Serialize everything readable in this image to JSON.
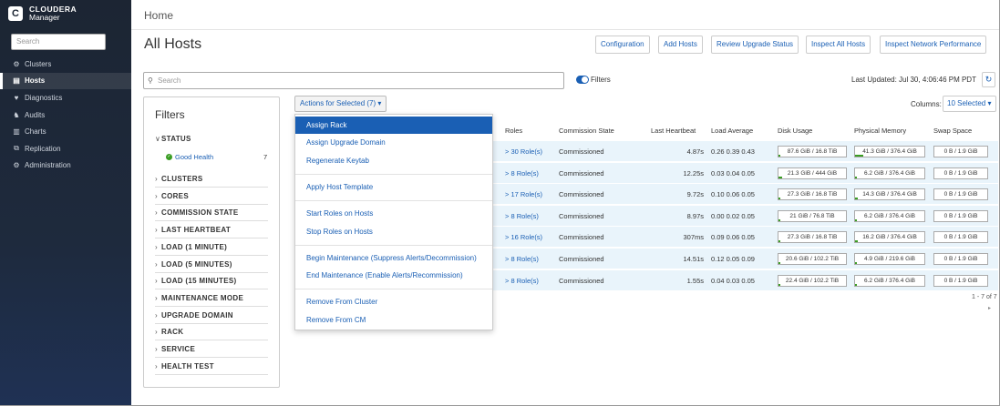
{
  "brand": {
    "line1": "CLOUDERA",
    "line2": "Manager",
    "mark": "C"
  },
  "sidebar": {
    "search_placeholder": "Search",
    "items": [
      {
        "label": "Clusters",
        "icon": "cluster-icon",
        "glyph": "⚙"
      },
      {
        "label": "Hosts",
        "icon": "hosts-icon",
        "glyph": "▤",
        "active": true
      },
      {
        "label": "Diagnostics",
        "icon": "heart-icon",
        "glyph": "♥"
      },
      {
        "label": "Audits",
        "icon": "audit-icon",
        "glyph": "♞"
      },
      {
        "label": "Charts",
        "icon": "chart-icon",
        "glyph": "▥"
      },
      {
        "label": "Replication",
        "icon": "replication-icon",
        "glyph": "⧉"
      },
      {
        "label": "Administration",
        "icon": "gear-icon",
        "glyph": "⚙"
      }
    ]
  },
  "breadcrumb": "Home",
  "page_title": "All Hosts",
  "buttons": [
    "Configuration",
    "Add Hosts",
    "Review Upgrade Status",
    "Inspect All Hosts",
    "Inspect Network Performance"
  ],
  "search": {
    "placeholder": "Search"
  },
  "filters_toggle_label": "Filters",
  "last_updated": "Last Updated: Jul 30, 4:06:46 PM PDT",
  "actions_label": "Actions for Selected (7) ▾",
  "columns_label": "Columns:",
  "columns_value": "10 Selected ▾",
  "filters_panel": {
    "title": "Filters",
    "status_label": "STATUS",
    "good_health": "Good Health",
    "good_health_count": "7",
    "groups": [
      "CLUSTERS",
      "CORES",
      "COMMISSION STATE",
      "LAST HEARTBEAT",
      "LOAD (1 MINUTE)",
      "LOAD (5 MINUTES)",
      "LOAD (15 MINUTES)",
      "MAINTENANCE MODE",
      "UPGRADE DOMAIN",
      "RACK",
      "SERVICE",
      "HEALTH TEST"
    ]
  },
  "table": {
    "headers": [
      "Roles",
      "Commission State",
      "Last Heartbeat",
      "Load Average",
      "Disk Usage",
      "Physical Memory",
      "Swap Space"
    ],
    "rows": [
      {
        "roles": "> 30 Role(s)",
        "state": "Commissioned",
        "heartbeat": "4.87s",
        "load": "0.26 0.39 0.43",
        "disk": "87.6 GiB / 16.8 TiB",
        "disk_frac": 0.01,
        "mem": "41.3 GiB / 376.4 GiB",
        "mem_frac": 0.11,
        "swap": "0 B / 1.9 GiB"
      },
      {
        "roles": "> 8 Role(s)",
        "state": "Commissioned",
        "heartbeat": "12.25s",
        "load": "0.03 0.04 0.05",
        "disk": "21.3 GiB / 444 GiB",
        "disk_frac": 0.05,
        "mem": "6.2 GiB / 376.4 GiB",
        "mem_frac": 0.02,
        "swap": "0 B / 1.9 GiB"
      },
      {
        "roles": "> 17 Role(s)",
        "state": "Commissioned",
        "heartbeat": "9.72s",
        "load": "0.10 0.06 0.05",
        "disk": "27.3 GiB / 16.8 TiB",
        "disk_frac": 0.0,
        "mem": "14.3 GiB / 376.4 GiB",
        "mem_frac": 0.04,
        "swap": "0 B / 1.9 GiB"
      },
      {
        "roles": "> 8 Role(s)",
        "state": "Commissioned",
        "heartbeat": "8.97s",
        "load": "0.00 0.02 0.05",
        "disk": "21 GiB / 76.8 TiB",
        "disk_frac": 0.0,
        "mem": "6.2 GiB / 376.4 GiB",
        "mem_frac": 0.02,
        "swap": "0 B / 1.9 GiB"
      },
      {
        "roles": "> 16 Role(s)",
        "state": "Commissioned",
        "heartbeat": "307ms",
        "load": "0.09 0.06 0.05",
        "disk": "27.3 GiB / 16.8 TiB",
        "disk_frac": 0.0,
        "mem": "16.2 GiB / 376.4 GiB",
        "mem_frac": 0.04,
        "swap": "0 B / 1.9 GiB"
      },
      {
        "roles": "> 8 Role(s)",
        "state": "Commissioned",
        "heartbeat": "14.51s",
        "load": "0.12 0.05 0.09",
        "disk": "20.6 GiB / 102.2 TiB",
        "disk_frac": 0.0,
        "mem": "4.9 GiB / 219.6 GiB",
        "mem_frac": 0.02,
        "swap": "0 B / 1.9 GiB"
      },
      {
        "roles": "> 8 Role(s)",
        "state": "Commissioned",
        "heartbeat": "1.55s",
        "load": "0.04 0.03 0.05",
        "disk": "22.4 GiB / 102.2 TiB",
        "disk_frac": 0.0,
        "mem": "6.2 GiB / 376.4 GiB",
        "mem_frac": 0.02,
        "swap": "0 B / 1.9 GiB"
      }
    ],
    "pager": "1 - 7 of 7"
  },
  "menu": {
    "groups": [
      [
        "Assign Rack",
        "Assign Upgrade Domain",
        "Regenerate Keytab"
      ],
      [
        "Apply Host Template"
      ],
      [
        "Start Roles on Hosts",
        "Stop Roles on Hosts"
      ],
      [
        "Begin Maintenance (Suppress Alerts/Decommission)",
        "End Maintenance (Enable Alerts/Recommission)"
      ],
      [
        "Remove From Cluster",
        "Remove From CM"
      ]
    ],
    "selected": "Assign Rack"
  },
  "colors": {
    "accent": "#1a5fb4",
    "sidebar": "#1c2533",
    "row": "#e9f4fb",
    "good": "#3a9d23"
  }
}
